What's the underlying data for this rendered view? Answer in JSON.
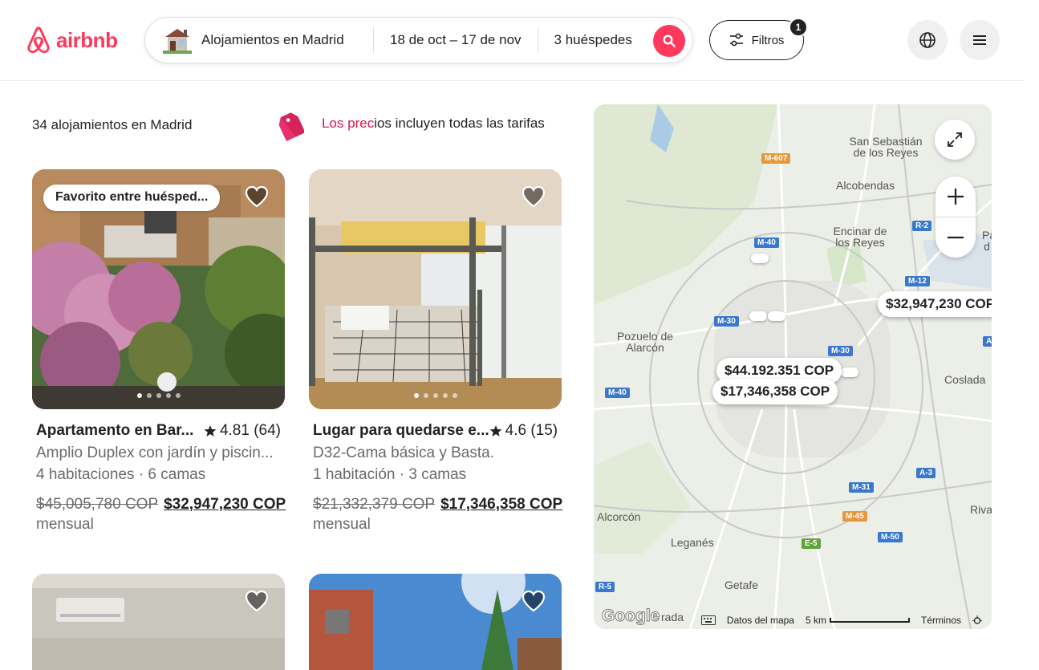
{
  "header": {
    "logo_text": "airbnb",
    "search": {
      "location": "Alojamientos en Madrid",
      "dates": "18 de oct – 17 de nov",
      "guests": "3 huéspedes"
    },
    "filters_label": "Filtros",
    "filters_count": "1"
  },
  "results": {
    "count_text": "34 alojamientos en Madrid",
    "price_note_highlight": "Los prec",
    "price_note_rest": "ios incluyen todas las tarifas"
  },
  "listings": [
    {
      "badge": "Favorito entre huésped...",
      "title": "Apartamento en Bar...",
      "rating": "4.81 (64)",
      "description": "Amplio Duplex con jardín y piscin...",
      "rooms": "4 habitaciones · 6 camas",
      "old_price": "$45,005,780 COP",
      "new_price": "$32,947,230 COP",
      "period": "mensual"
    },
    {
      "title": "Lugar para quedarse e...",
      "rating": "4.6 (15)",
      "description": "D32-Cama básica y Basta.",
      "rooms": "1 habitación · 3 camas",
      "old_price": "$21,332,379 COP",
      "new_price": "$17,346,358 COP",
      "period": "mensual"
    }
  ],
  "map": {
    "pins": {
      "pin1": "$32,947,230 COP",
      "pin2": "$44.192.351 COP",
      "pin3": "$17,346,358 COP"
    },
    "places": {
      "san_sebastian": "San Sebastián de los Reyes",
      "alcobendas": "Alcobendas",
      "encinar": "Encinar de los Reyes",
      "pozuelo": "Pozuelo de Alarcón",
      "coslada": "Coslada",
      "alcorcon": "Alcorcón",
      "leganes": "Leganés",
      "getafe": "Getafe",
      "rivas": "Rivas",
      "parla_edge": "Pa d",
      "fuenlabrada_edge": "rada"
    },
    "highways": {
      "m607": "M-607",
      "m40a": "M-40",
      "r2": "R-2",
      "m12": "M-12",
      "m30a": "M-30",
      "m30b": "M-30",
      "a_edge": "A",
      "m40b": "M-40",
      "a3": "A-3",
      "m31": "M-31",
      "m45": "M-45",
      "e5": "E-5",
      "m50": "M-50",
      "r5": "R-5"
    },
    "footer": {
      "google": "Google",
      "map_data": "Datos del mapa",
      "scale": "5 km",
      "terms": "Términos"
    }
  }
}
